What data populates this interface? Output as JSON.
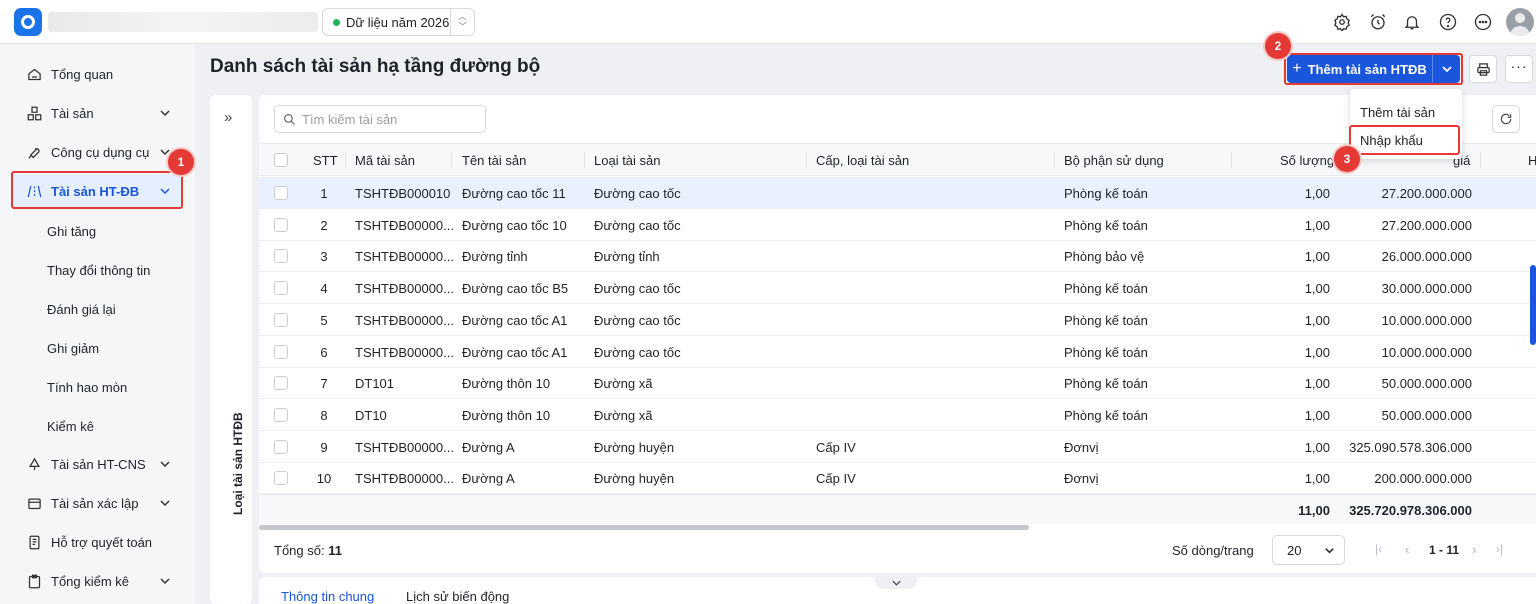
{
  "topbar": {
    "year_label": "Dữ liệu năm 2026",
    "icons": [
      "settings-icon",
      "alarm-icon",
      "bell-icon",
      "help-icon",
      "more-icon"
    ]
  },
  "sidebar": {
    "items": [
      {
        "label": "Tổng quan"
      },
      {
        "label": "Tài sản"
      },
      {
        "label": "Công cụ dụng cụ"
      },
      {
        "label": "Tài sản HT-ĐB"
      },
      {
        "label": "Tài sản HT-CNS"
      },
      {
        "label": "Tài sản xác lập"
      },
      {
        "label": "Hỗ trợ quyết toán"
      },
      {
        "label": "Tổng kiểm kê"
      }
    ],
    "subitems": [
      "Ghi tăng",
      "Thay đổi thông tin",
      "Đánh giá lại",
      "Ghi giảm",
      "Tính hao mòn",
      "Kiểm kê"
    ]
  },
  "header": {
    "title": "Danh sách tài sản hạ tầng đường bộ",
    "add_button": "Thêm tài sản HTĐB"
  },
  "dropdown": {
    "items": [
      "Thêm tài sản",
      "Nhập khẩu"
    ]
  },
  "badges": {
    "one": "1",
    "two": "2",
    "three": "3"
  },
  "left_panel": {
    "collapse": "»",
    "vertical_label": "Loại tài sản HTĐB"
  },
  "search": {
    "placeholder": "Tìm kiếm tài sản"
  },
  "table": {
    "headers": {
      "stt": "STT",
      "code": "Mã tài sản",
      "name": "Tên tài sản",
      "type": "Loại tài sản",
      "level": "Cấp, loại tài sản",
      "dept": "Bộ phận sử dụng",
      "qty": "Số lượng",
      "value": "giá",
      "hidden": "H"
    },
    "rows": [
      {
        "stt": "1",
        "code": "TSHTĐB000010",
        "name": "Đường cao tốc 11",
        "type": "Đường cao tốc",
        "level": "",
        "dept": "Phòng kế toán",
        "qty": "1,00",
        "value": "27.200.000.000"
      },
      {
        "stt": "2",
        "code": "TSHTĐB00000...",
        "name": "Đường cao tốc 10",
        "type": "Đường cao tốc",
        "level": "",
        "dept": "Phòng kế toán",
        "qty": "1,00",
        "value": "27.200.000.000"
      },
      {
        "stt": "3",
        "code": "TSHTĐB00000...",
        "name": "Đường tỉnh",
        "type": "Đường tỉnh",
        "level": "",
        "dept": "Phòng bảo vệ",
        "qty": "1,00",
        "value": "26.000.000.000"
      },
      {
        "stt": "4",
        "code": "TSHTĐB00000...",
        "name": "Đường cao tốc B5",
        "type": "Đường cao tốc",
        "level": "",
        "dept": "Phòng kế toán",
        "qty": "1,00",
        "value": "30.000.000.000"
      },
      {
        "stt": "5",
        "code": "TSHTĐB00000...",
        "name": "Đường cao tốc A1",
        "type": "Đường cao tốc",
        "level": "",
        "dept": "Phòng kế toán",
        "qty": "1,00",
        "value": "10.000.000.000"
      },
      {
        "stt": "6",
        "code": "TSHTĐB00000...",
        "name": "Đường cao tốc A1",
        "type": "Đường cao tốc",
        "level": "",
        "dept": "Phòng kế toán",
        "qty": "1,00",
        "value": "10.000.000.000"
      },
      {
        "stt": "7",
        "code": "DT101",
        "name": "Đường thôn 10",
        "type": "Đường xã",
        "level": "",
        "dept": "Phòng kế toán",
        "qty": "1,00",
        "value": "50.000.000.000"
      },
      {
        "stt": "8",
        "code": "DT10",
        "name": "Đường thôn 10",
        "type": "Đường xã",
        "level": "",
        "dept": "Phòng kế toán",
        "qty": "1,00",
        "value": "50.000.000.000"
      },
      {
        "stt": "9",
        "code": "TSHTĐB00000...",
        "name": "Đường A",
        "type": "Đường huyện",
        "level": "Cấp IV",
        "dept": "Đơnvị",
        "qty": "1,00",
        "value": "325.090.578.306.000"
      },
      {
        "stt": "10",
        "code": "TSHTĐB00000...",
        "name": "Đường A",
        "type": "Đường huyện",
        "level": "Cấp IV",
        "dept": "Đơnvị",
        "qty": "1,00",
        "value": "200.000.000.000"
      }
    ],
    "total_qty": "11,00",
    "total_value": "325.720.978.306.000"
  },
  "footer": {
    "total_label": "Tổng số:",
    "total_count": "11",
    "rows_per_page_label": "Số dòng/trang",
    "page_size": "20",
    "range": "1 - 11"
  },
  "bottom_tabs": [
    "Thông tin chung",
    "Lịch sử biến động"
  ],
  "colors": {
    "primary": "#1a56db",
    "highlight": "#e53935",
    "selected_row": "#e9f1fe"
  }
}
